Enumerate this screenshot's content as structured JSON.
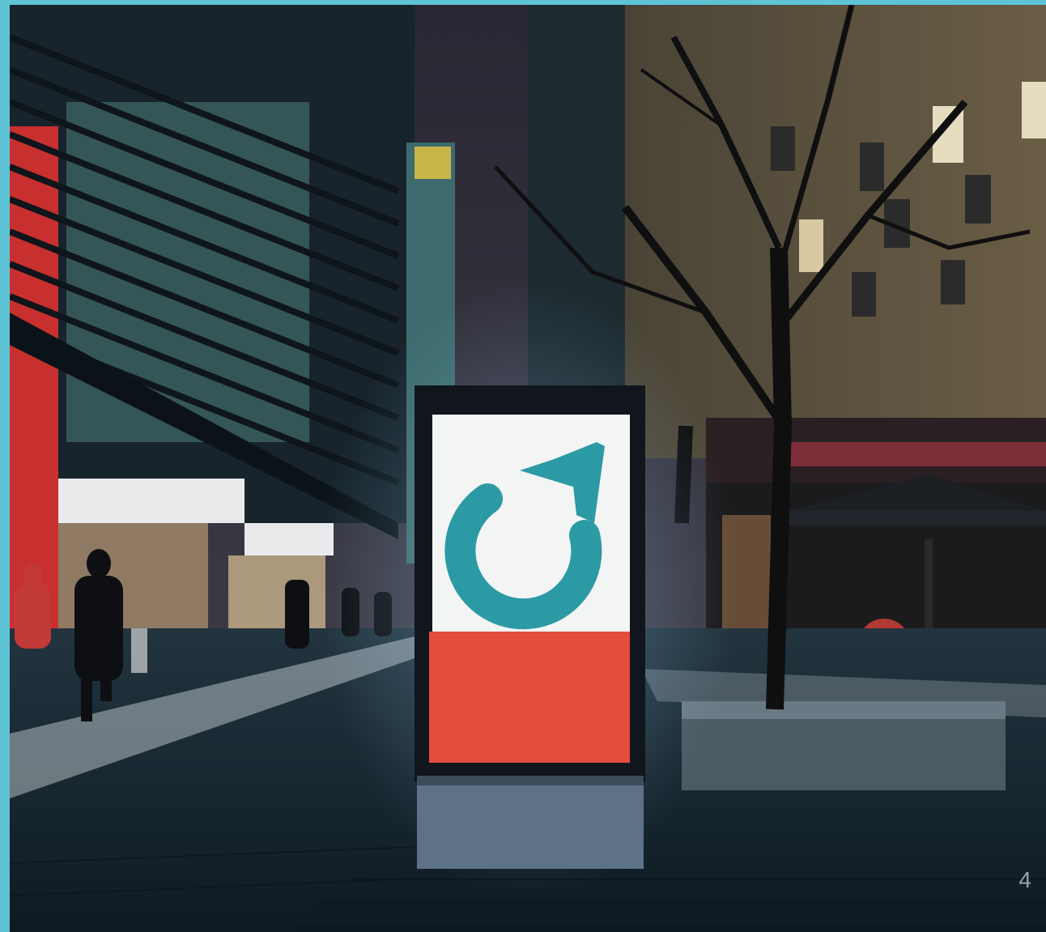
{
  "page": {
    "number": "4"
  },
  "colors": {
    "frame_accent": "#5fc3d6",
    "logo_teal": "#2b9aa5",
    "panel_white": "#f3f4f4",
    "panel_red": "#e24e3b",
    "page_number": "#9aa3a8"
  },
  "scene": {
    "logo_icon": "circular-arrow-logo-icon"
  }
}
